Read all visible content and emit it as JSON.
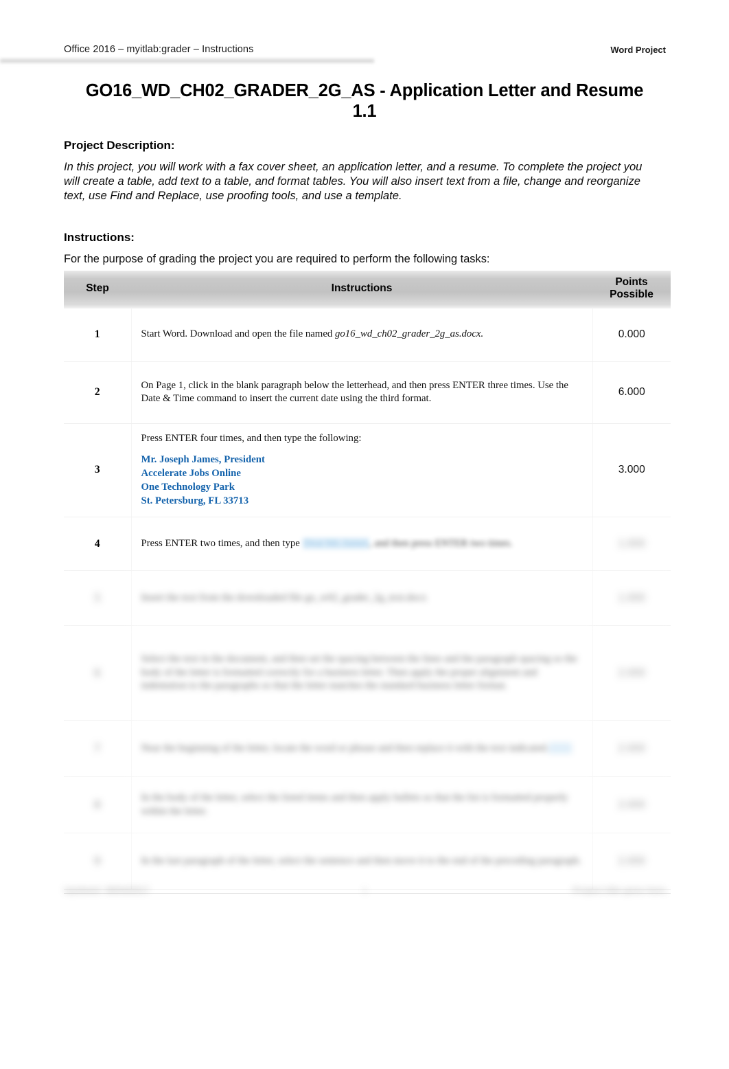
{
  "header": {
    "left": "Office 2016 – myitlab:grader – Instructions",
    "right": "Word Project"
  },
  "title": "GO16_WD_CH02_GRADER_2G_AS - Application Letter and Resume 1.1",
  "project_description": {
    "heading": "Project Description:",
    "body": "In this project, you will work with a fax cover sheet, an application letter, and a resume. To complete the project you will create a table, add text to a table, and format tables. You will also insert text from a file, change and reorganize text, use Find and Replace, use proofing tools, and use a template."
  },
  "instructions": {
    "heading": "Instructions:",
    "lead": "For the purpose of grading the project you are required to perform the following tasks:"
  },
  "table": {
    "columns": {
      "step": "Step",
      "instructions": "Instructions",
      "points": "Points Possible"
    },
    "rows": [
      {
        "step": "1",
        "instruction_text": "Start Word. Download and open the file named ",
        "instruction_italic": "go16_wd_ch02_grader_2g_as.docx.",
        "points": "0.000",
        "state": "visible"
      },
      {
        "step": "2",
        "instruction_text": "On Page 1, click in the blank paragraph below the letterhead, and then press ENTER three times. Use the Date & Time command to insert the current date using the third format.",
        "points": "6.000",
        "state": "visible"
      },
      {
        "step": "3",
        "instruction_text": "Press ENTER four times, and then type the following:",
        "address_lines": [
          "Mr. Joseph James, President",
          "Accelerate Jobs Online",
          "One Technology Park",
          "St. Petersburg, FL 33713"
        ],
        "points": "3.000",
        "state": "visible"
      },
      {
        "step": "4",
        "instruction_text": "Press ENTER two times, and then type ",
        "instruction_redacted_highlight": "Dear Mr. James",
        "instruction_redacted_tail": ", and then press ENTER two times.",
        "points": "1.000",
        "state": "partially-redacted"
      },
      {
        "step": "5",
        "instruction_redacted": "Insert the text from the downloaded file go_w02_grader_2g_text.docx",
        "points": "1.000",
        "state": "redacted"
      },
      {
        "step": "6",
        "instruction_redacted": "Select the text in the document, and then set the spacing between the lines and the paragraph spacing so the body of the letter is formatted correctly for a business letter. Then apply the proper alignment and indentation to the paragraphs so that the letter matches the standard business letter format.",
        "points": "2.000",
        "state": "redacted"
      },
      {
        "step": "7",
        "instruction_redacted": "Near the beginning of the letter, locate the word or phrase and then replace it with the text indicated.",
        "points": "2.000",
        "state": "redacted"
      },
      {
        "step": "8",
        "instruction_redacted": "In the body of the letter, select the listed items and then apply bullets so that the list is formatted properly within the letter.",
        "points": "2.000",
        "state": "redacted"
      },
      {
        "step": "9",
        "instruction_redacted": "In the last paragraph of the letter, select the sentence and then move it to the end of the preceding paragraph.",
        "points": "2.000",
        "state": "redacted"
      }
    ]
  },
  "footer": {
    "left": "Updated: 08/04/2017",
    "center": "1",
    "right": "Project title goes here"
  },
  "colors": {
    "accent_blue": "#1463AC",
    "link_blue": "#5aa6dd",
    "highlight_blue": "#cfe6f7",
    "header_gray": "#c2c2c2",
    "page_background": "#ffffff"
  }
}
